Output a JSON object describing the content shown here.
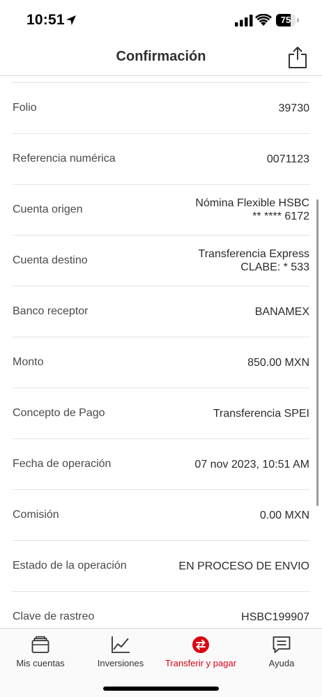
{
  "status_bar": {
    "time": "10:51",
    "battery_level": "75",
    "battery_fraction": 0.75
  },
  "header": {
    "title": "Confirmación",
    "share_icon": "share-icon"
  },
  "details": [
    {
      "label": "Folio",
      "value": [
        "39730"
      ]
    },
    {
      "label": "Referencia numérica",
      "value": [
        "0071123"
      ]
    },
    {
      "label": "Cuenta origen",
      "value": [
        "Nómina Flexible HSBC",
        "** **** 6172"
      ]
    },
    {
      "label": "Cuenta destino",
      "value": [
        "Transferencia Express",
        "CLABE: * 533"
      ]
    },
    {
      "label": "Banco receptor",
      "value": [
        "BANAMEX"
      ]
    },
    {
      "label": "Monto",
      "value": [
        "850.00 MXN"
      ]
    },
    {
      "label": "Concepto de Pago",
      "value": [
        "Transferencia SPEI"
      ]
    },
    {
      "label": "Fecha de operación",
      "value": [
        "07 nov 2023, 10:51 AM"
      ]
    },
    {
      "label": "Comisión",
      "value": [
        "0.00 MXN"
      ]
    },
    {
      "label": "Estado de la operación",
      "value": [
        "EN PROCESO DE ENVIO"
      ]
    },
    {
      "label": "Clave de rastreo",
      "value": [
        "HSBC199907"
      ]
    }
  ],
  "tab_bar": {
    "active_color": "#db0011",
    "tabs": [
      {
        "label": "Mis cuentas",
        "icon": "wallet-icon"
      },
      {
        "label": "Inversiones",
        "icon": "chart-line-icon"
      },
      {
        "label": "Transferir y pagar",
        "icon": "transfer-icon"
      },
      {
        "label": "Ayuda",
        "icon": "chat-icon"
      }
    ]
  }
}
